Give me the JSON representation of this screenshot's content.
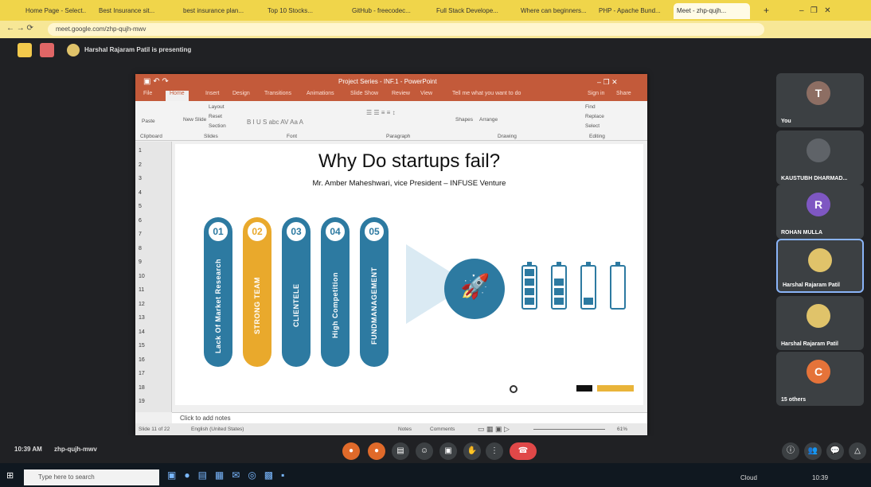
{
  "browser": {
    "tabs": [
      {
        "label": "Home Page - Select..."
      },
      {
        "label": "Best Insurance sit..."
      },
      {
        "label": "best insurance plan..."
      },
      {
        "label": "Top 10 Stocks..."
      },
      {
        "label": "GitHub - freecodec..."
      },
      {
        "label": "Full Stack Develope..."
      },
      {
        "label": "Where can beginners..."
      },
      {
        "label": "PHP - Apache Bund..."
      },
      {
        "label": "Meet - zhp-qujh..."
      }
    ],
    "url": "meet.google.com/zhp-qujh-mwv"
  },
  "meet": {
    "presenter_text": "Harshal Rajaram Patil is presenting",
    "time": "10:39 AM",
    "meeting_code": "zhp-qujh-mwv",
    "participants": [
      {
        "name": "You",
        "initial": "T",
        "color": "#8d6e63"
      },
      {
        "name": "KAUSTUBH DHARMAD...",
        "initial": "",
        "color": "#5f6368"
      },
      {
        "name": "ROHAN MULLA",
        "initial": "R",
        "color": "#7e57c2"
      },
      {
        "name": "Harshal Rajaram Patil",
        "initial": "",
        "color": "#e0c36a"
      },
      {
        "name": "Harshal Rajaram Patil",
        "initial": "",
        "color": "#e0c36a"
      },
      {
        "name": "15 others",
        "initial": "C",
        "color": "#e57339"
      }
    ]
  },
  "ppt": {
    "title": "Project Series - INF.1 - PowerPoint",
    "ribbon_tabs": [
      "File",
      "Home",
      "Insert",
      "Design",
      "Transitions",
      "Animations",
      "Slide Show",
      "Review",
      "View",
      "Tell me what you want to do"
    ],
    "ribbon_right": [
      "Sign in",
      "Share"
    ],
    "groups": [
      "Clipboard",
      "Slides",
      "Font",
      "Paragraph",
      "Drawing",
      "Editing"
    ],
    "buttons": {
      "paste": "Paste",
      "new_slide": "New Slide",
      "layout": "Layout",
      "reset": "Reset",
      "section": "Section",
      "shapes": "Shapes",
      "arrange": "Arrange",
      "find": "Find",
      "replace": "Replace",
      "select": "Select"
    },
    "thumb_numbers": [
      "1",
      "2",
      "3",
      "4",
      "5",
      "6",
      "7",
      "8",
      "9",
      "10",
      "11",
      "12",
      "13",
      "14",
      "15",
      "16",
      "17",
      "18",
      "19"
    ],
    "notes": "Click to add notes",
    "status": {
      "slide": "Slide 11 of 22",
      "language": "English (United States)",
      "notes_btn": "Notes",
      "comments_btn": "Comments",
      "zoom": "61%"
    }
  },
  "slide": {
    "title": "Why Do startups fail?",
    "subtitle": "Mr. Amber Maheshwari, vice President – INFUSE Venture",
    "pillars": [
      {
        "num": "01",
        "label": "Lack Of Market Research",
        "color": "#2d7aa1"
      },
      {
        "num": "02",
        "label": "STRONG TEAM",
        "color": "#e9a92c"
      },
      {
        "num": "03",
        "label": "CLIENTELE",
        "color": "#2d7aa1"
      },
      {
        "num": "04",
        "label": "High Competition",
        "color": "#2d7aa1"
      },
      {
        "num": "05",
        "label": "FUNDMANAGEMENT",
        "color": "#2d7aa1"
      }
    ],
    "batteries": [
      4,
      3,
      1,
      0
    ]
  },
  "taskbar": {
    "search": "Type here to search",
    "weather": "Cloud",
    "clock": "10:39"
  }
}
